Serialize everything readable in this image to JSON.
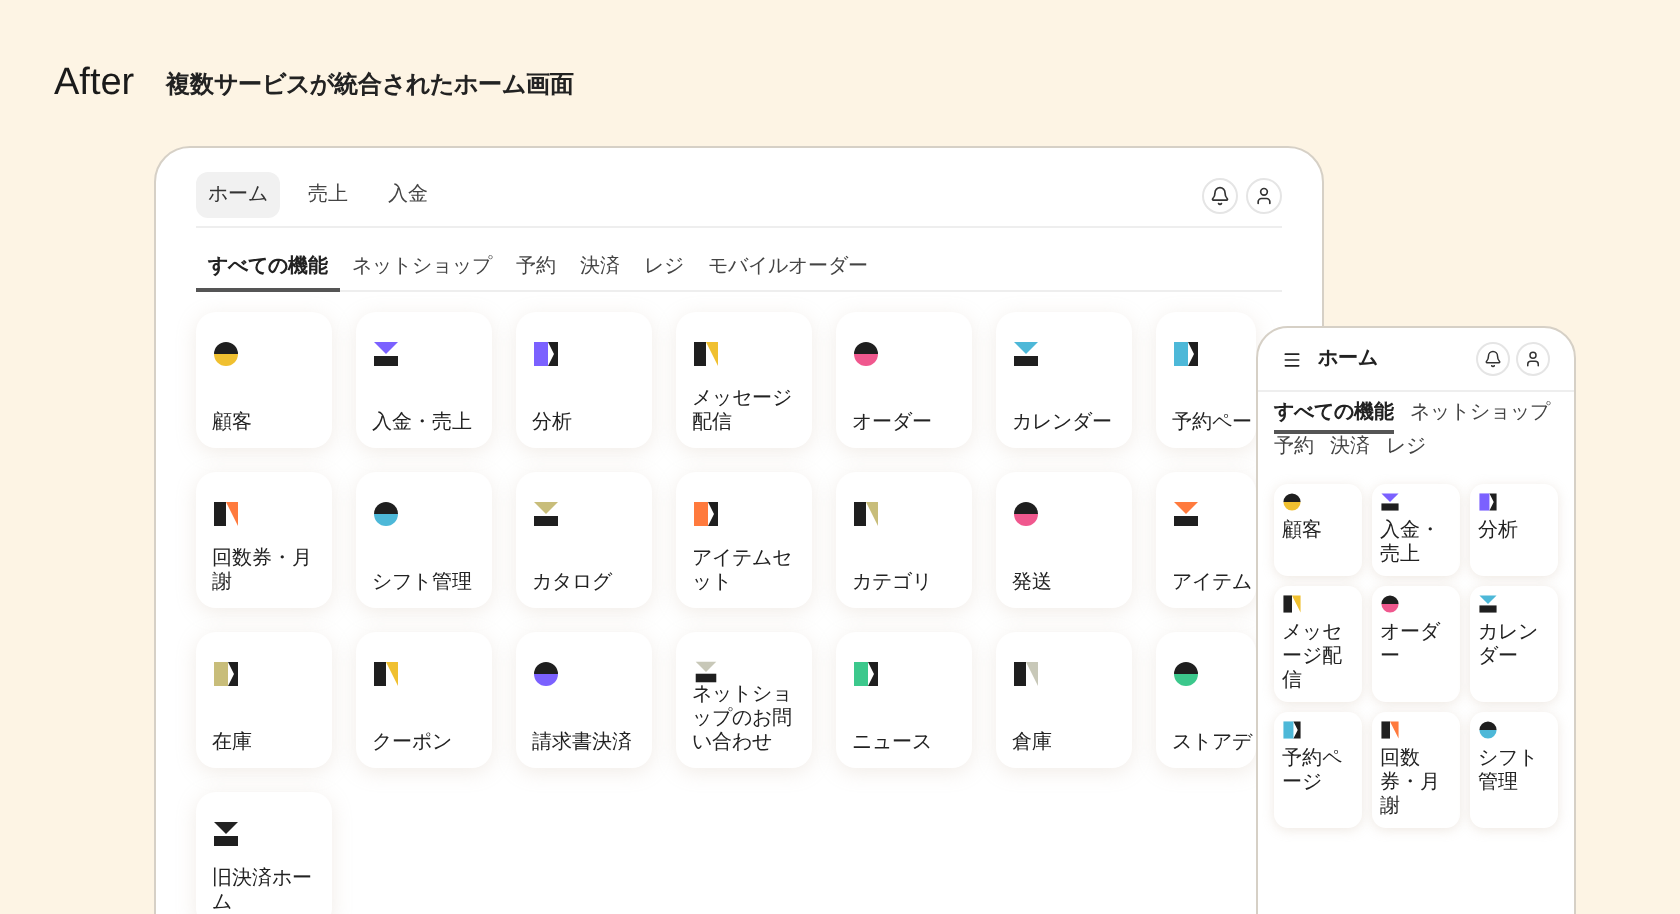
{
  "header": {
    "title": "After",
    "subtitle": "複数サービスが統合されたホーム画面"
  },
  "desktop": {
    "nav_tabs": [
      {
        "label": "ホーム",
        "selected": true
      },
      {
        "label": "売上",
        "selected": false
      },
      {
        "label": "入金",
        "selected": false
      }
    ],
    "category_tabs": [
      {
        "label": "すべての機能",
        "selected": true
      },
      {
        "label": "ネットショップ",
        "selected": false
      },
      {
        "label": "予約",
        "selected": false
      },
      {
        "label": "決済",
        "selected": false
      },
      {
        "label": "レジ",
        "selected": false
      },
      {
        "label": "モバイルオーダー",
        "selected": false
      }
    ],
    "cards": [
      {
        "label": "顧客",
        "color": "#f0c030"
      },
      {
        "label": "入金・売上",
        "color": "#7b61ff"
      },
      {
        "label": "分析",
        "color": "#7b61ff"
      },
      {
        "label": "メッセージ配信",
        "color": "#f0c030"
      },
      {
        "label": "オーダー",
        "color": "#f0588e"
      },
      {
        "label": "カレンダー",
        "color": "#4db8d8"
      },
      {
        "label": "予約ペー",
        "color": "#4db8d8"
      },
      {
        "label": "回数券・月謝",
        "color": "#ff7a3d"
      },
      {
        "label": "シフト管理",
        "color": "#4db8d8"
      },
      {
        "label": "カタログ",
        "color": "#c8bd7a"
      },
      {
        "label": "アイテムセット",
        "color": "#ff7a3d"
      },
      {
        "label": "カテゴリ",
        "color": "#c8bd7a"
      },
      {
        "label": "発送",
        "color": "#f0588e"
      },
      {
        "label": "アイテム",
        "color": "#ff7a3d"
      },
      {
        "label": "在庫",
        "color": "#c8bd7a"
      },
      {
        "label": "クーポン",
        "color": "#f0c030"
      },
      {
        "label": "請求書決済",
        "color": "#7b61ff"
      },
      {
        "label": "ネットショップのお問い合わせ",
        "color": "#c8c8b8"
      },
      {
        "label": "ニュース",
        "color": "#3cc88c"
      },
      {
        "label": "倉庫",
        "color": "#c8c8b8"
      },
      {
        "label": "ストアデ",
        "color": "#3cc88c"
      },
      {
        "label": "旧決済ホーム",
        "color": "#222222"
      }
    ]
  },
  "mobile": {
    "title": "ホーム",
    "tabs": [
      {
        "label": "すべての機能",
        "selected": true
      },
      {
        "label": "ネットショップ",
        "selected": false
      },
      {
        "label": "予約",
        "selected": false
      },
      {
        "label": "決済",
        "selected": false
      },
      {
        "label": "レジ",
        "selected": false
      }
    ],
    "cards": [
      {
        "label": "顧客",
        "color": "#f0c030"
      },
      {
        "label": "入金・売上",
        "color": "#7b61ff"
      },
      {
        "label": "分析",
        "color": "#7b61ff"
      },
      {
        "label": "メッセージ配信",
        "color": "#f0c030"
      },
      {
        "label": "オーダー",
        "color": "#f0588e"
      },
      {
        "label": "カレンダー",
        "color": "#4db8d8"
      },
      {
        "label": "予約ページ",
        "color": "#4db8d8"
      },
      {
        "label": "回数券・月謝",
        "color": "#ff7a3d"
      },
      {
        "label": "シフト管理",
        "color": "#4db8d8"
      }
    ]
  }
}
